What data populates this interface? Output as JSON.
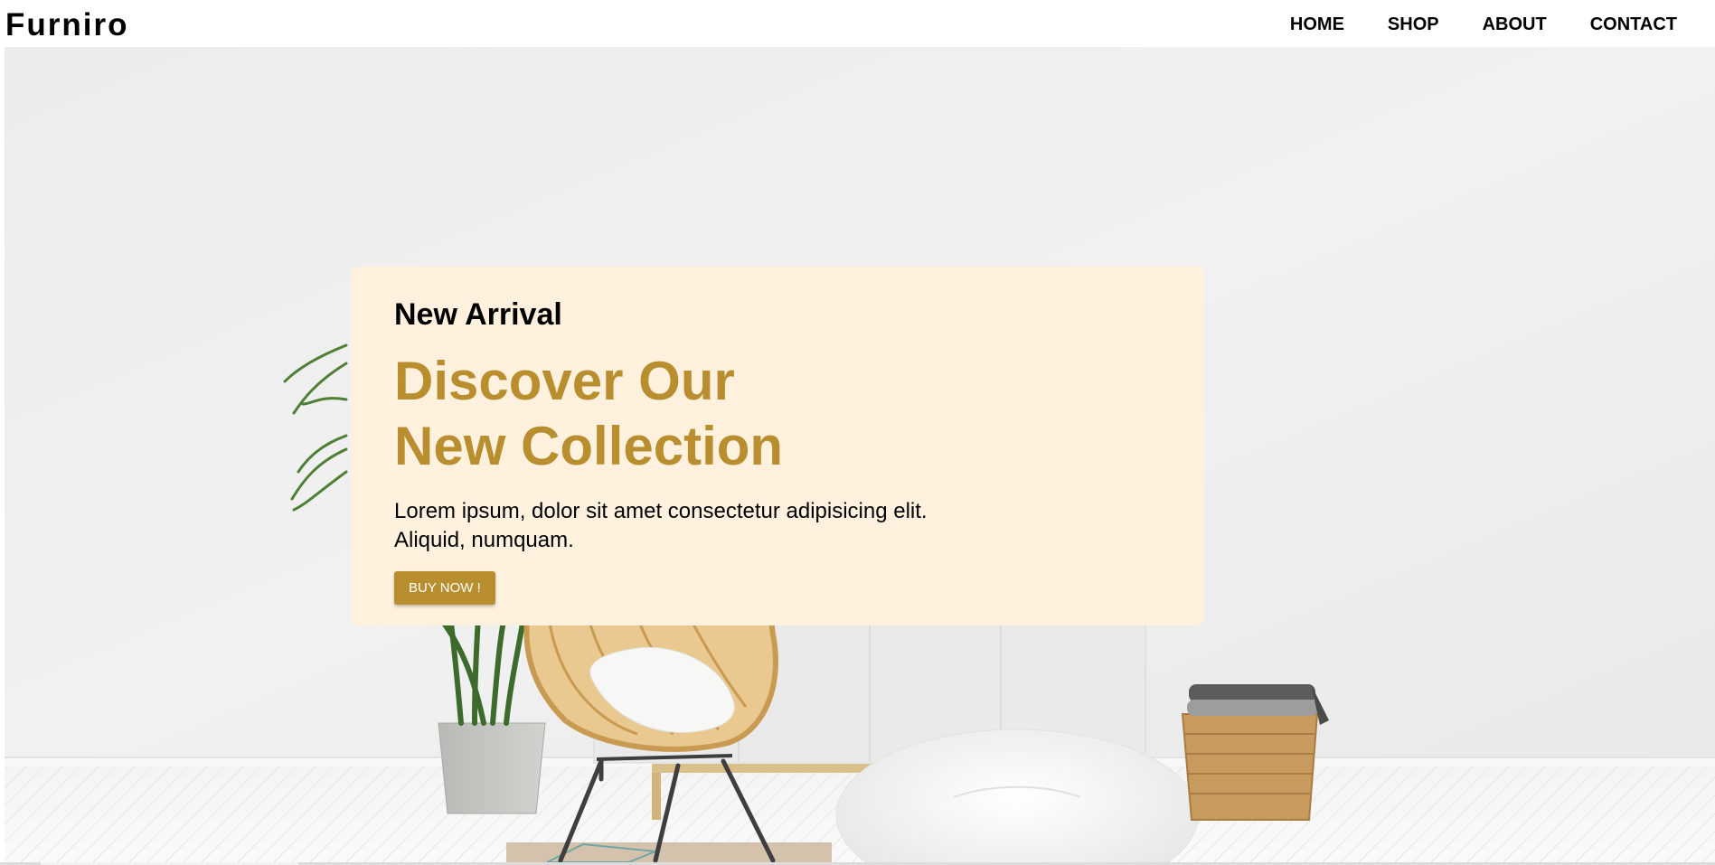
{
  "brand": {
    "logo": "Furniro"
  },
  "nav": {
    "links": [
      {
        "label": "HOME"
      },
      {
        "label": "SHOP"
      },
      {
        "label": "ABOUT"
      },
      {
        "label": "CONTACT"
      }
    ]
  },
  "hero": {
    "eyebrow": "New Arrival",
    "headline_line1": "Discover Our",
    "headline_line2": "New Collection",
    "description_line1": "Lorem ipsum, dolor sit amet consectetur adipisicing elit.",
    "description_line2": "Aliquid, numquam.",
    "cta_label": "BUY NOW !"
  },
  "colors": {
    "accent": "#b88e2f",
    "card_background": "#fff1de",
    "wall": "#efefef"
  }
}
